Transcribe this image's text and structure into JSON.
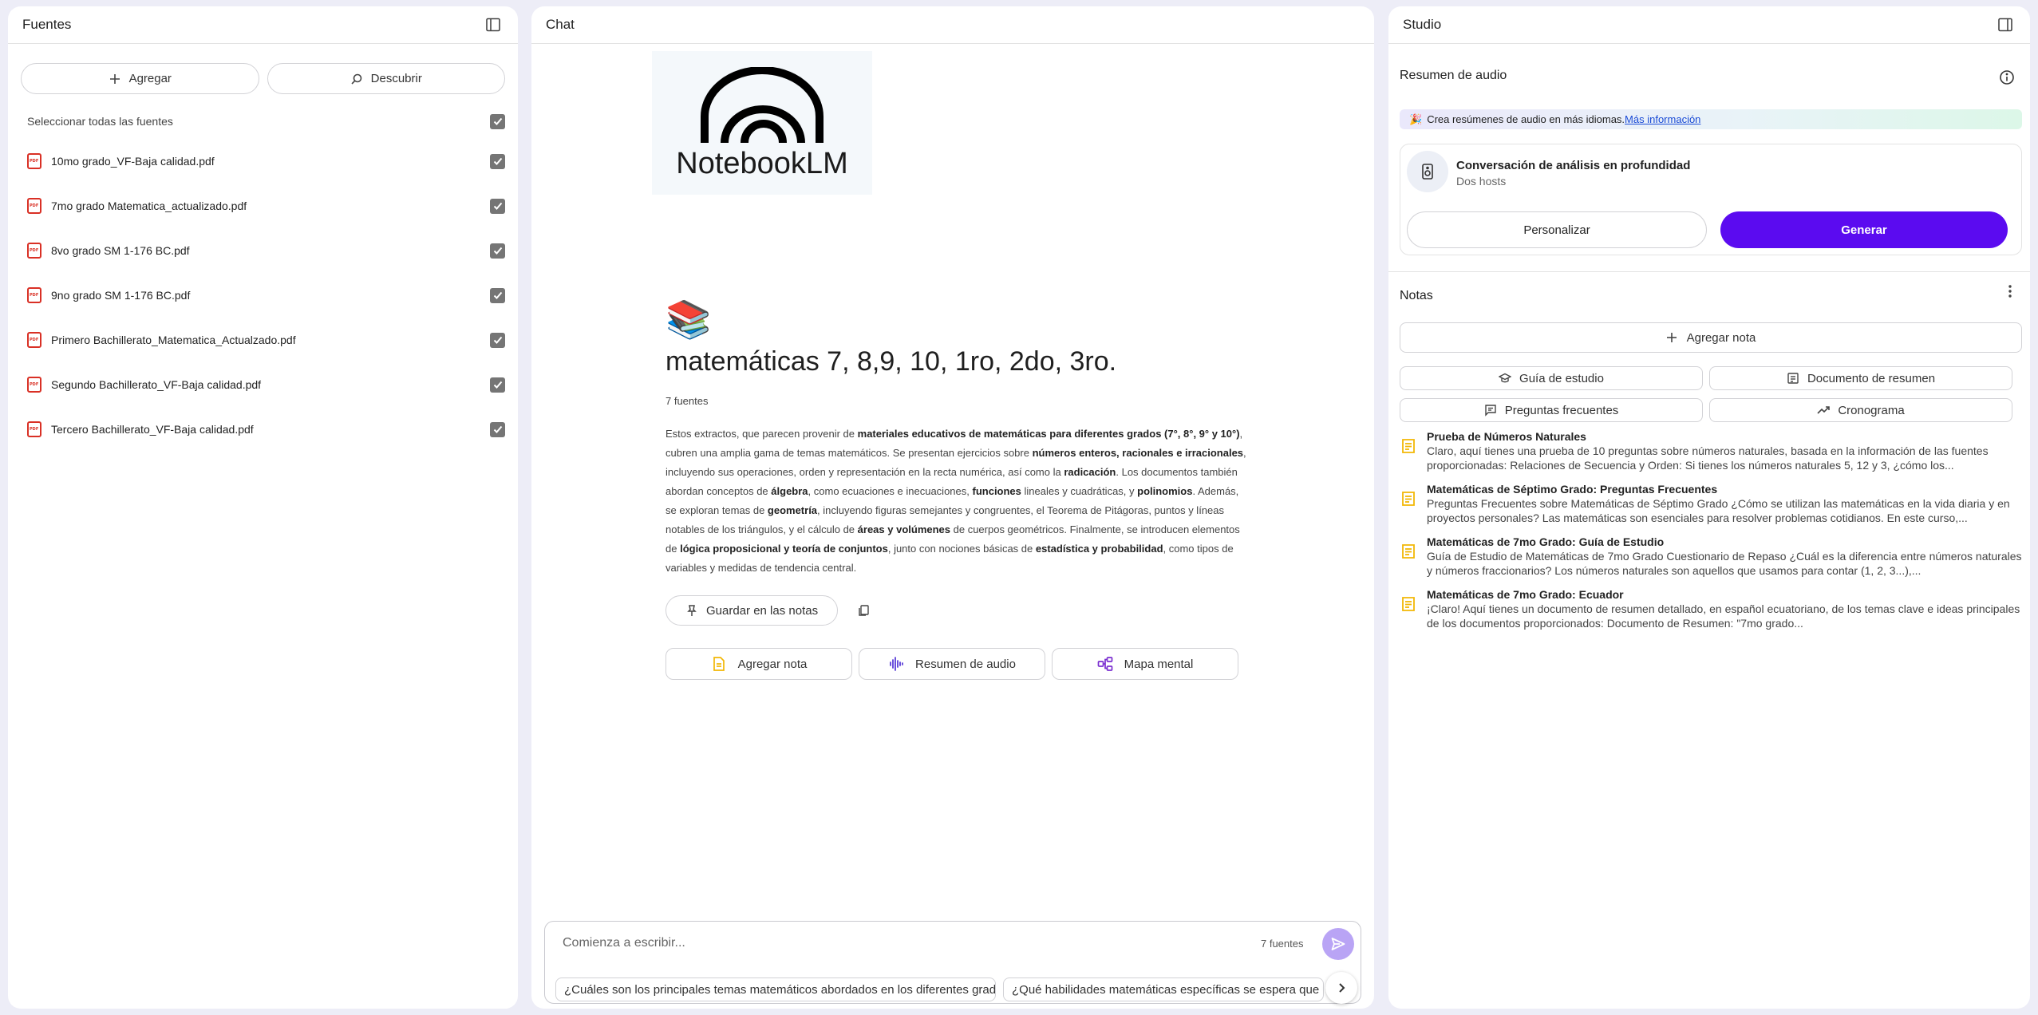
{
  "sources": {
    "title": "Fuentes",
    "add_label": "Agregar",
    "discover_label": "Descubrir",
    "select_all_label": "Seleccionar todas las fuentes",
    "items": [
      {
        "name": "10mo grado_VF-Baja calidad.pdf"
      },
      {
        "name": "7mo grado Matematica_actualizado.pdf"
      },
      {
        "name": "8vo grado SM 1-176 BC.pdf"
      },
      {
        "name": "9no grado SM 1-176 BC.pdf"
      },
      {
        "name": "Primero Bachillerato_Matematica_Actualzado.pdf"
      },
      {
        "name": "Segundo Bachillerato_VF-Baja calidad.pdf"
      },
      {
        "name": "Tercero Bachillerato_VF-Baja calidad.pdf"
      }
    ]
  },
  "chat": {
    "title": "Chat",
    "logo_text": "NotebookLM",
    "emoji": "📚",
    "notebook_title": "matemáticas 7, 8,9, 10, 1ro, 2do, 3ro.",
    "source_count": "7 fuentes",
    "summary": [
      {
        "t": "Estos extractos, que parecen provenir de "
      },
      {
        "t": "materiales educativos de matemáticas para diferentes grados (7°, 8°, 9° y 10°)",
        "b": true
      },
      {
        "t": ", cubren una amplia gama de temas matemáticos. Se presentan ejercicios sobre "
      },
      {
        "t": "números enteros, racionales e irracionales",
        "b": true
      },
      {
        "t": ", incluyendo sus operaciones, orden y representación en la recta numérica, así como la "
      },
      {
        "t": "radicación",
        "b": true
      },
      {
        "t": ". Los documentos también abordan conceptos de "
      },
      {
        "t": "álgebra",
        "b": true
      },
      {
        "t": ", como ecuaciones e inecuaciones, "
      },
      {
        "t": "funciones",
        "b": true
      },
      {
        "t": " lineales y cuadráticas, y "
      },
      {
        "t": "polinomios",
        "b": true
      },
      {
        "t": ". Además, se exploran temas de "
      },
      {
        "t": "geometría",
        "b": true
      },
      {
        "t": ", incluyendo figuras semejantes y congruentes, el Teorema de Pitágoras, puntos y líneas notables de los triángulos, y el cálculo de "
      },
      {
        "t": "áreas y volúmenes",
        "b": true
      },
      {
        "t": " de cuerpos geométricos. Finalmente, se introducen elementos de "
      },
      {
        "t": "lógica proposicional y teoría de conjuntos",
        "b": true
      },
      {
        "t": ", junto con nociones básicas de "
      },
      {
        "t": "estadística y probabilidad",
        "b": true
      },
      {
        "t": ", como tipos de variables y medidas de tendencia central."
      }
    ],
    "save_label": "Guardar en las notas",
    "chips": {
      "add_note": "Agregar nota",
      "audio_summary": "Resumen de audio",
      "mind_map": "Mapa mental"
    },
    "input_placeholder": "Comienza a escribir...",
    "input_source_count": "7 fuentes",
    "suggestions": [
      "¿Cuáles son los principales temas matemáticos abordados en los diferentes grados?",
      "¿Qué habilidades matemáticas específicas se espera que los"
    ]
  },
  "studio": {
    "title": "Studio",
    "audio_section": "Resumen de audio",
    "promo_emoji": "🎉",
    "promo_text": "Crea resúmenes de audio en más idiomas.",
    "promo_link": "Más información",
    "audio_card_title": "Conversación de análisis en profundidad",
    "audio_card_subtitle": "Dos hosts",
    "customize_label": "Personalizar",
    "generate_label": "Generar",
    "notes_section": "Notas",
    "add_note_label": "Agregar nota",
    "tools": {
      "study_guide": "Guía de estudio",
      "summary_doc": "Documento de resumen",
      "faq": "Preguntas frecuentes",
      "timeline": "Cronograma"
    },
    "notes": [
      {
        "title": "Prueba de Números Naturales",
        "preview": "Claro, aquí tienes una prueba de 10 preguntas sobre números naturales, basada en la información de las fuentes proporcionadas: Relaciones de Secuencia y Orden: Si tienes los números naturales 5, 12 y 3, ¿cómo los..."
      },
      {
        "title": "Matemáticas de Séptimo Grado: Preguntas Frecuentes",
        "preview": "Preguntas Frecuentes sobre Matemáticas de Séptimo Grado ¿Cómo se utilizan las matemáticas en la vida diaria y en proyectos personales? Las matemáticas son esenciales para resolver problemas cotidianos. En este curso,..."
      },
      {
        "title": "Matemáticas de 7mo Grado: Guía de Estudio",
        "preview": "Guía de Estudio de Matemáticas de 7mo Grado Cuestionario de Repaso ¿Cuál es la diferencia entre números naturales y números fraccionarios? Los números naturales son aquellos que usamos para contar (1, 2, 3...),..."
      },
      {
        "title": "Matemáticas de 7mo Grado: Ecuador",
        "preview": "¡Claro! Aquí tienes un documento de resumen detallado, en español ecuatoriano, de los temas clave e ideas principales de los documentos proporcionados: Documento de Resumen: \"7mo grado..."
      }
    ]
  },
  "colors": {
    "accent": "#5b0bf0",
    "send_button": "#b9a4f5",
    "pdf_red": "#d93025",
    "note_yellow": "#f2b705"
  }
}
